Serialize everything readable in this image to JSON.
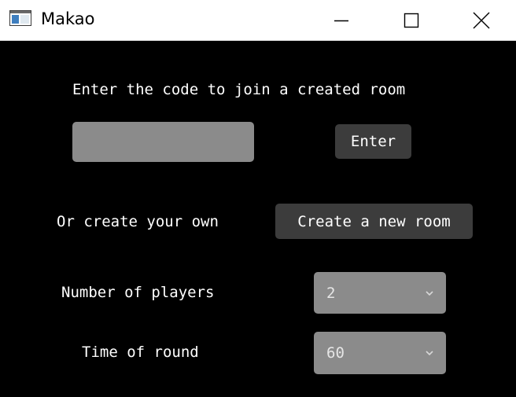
{
  "window": {
    "title": "Makao",
    "icon": "app-window-icon",
    "controls": {
      "minimize_icon": "minimize-icon",
      "maximize_icon": "maximize-icon",
      "close_icon": "close-icon"
    }
  },
  "join": {
    "prompt": "Enter the code to join a created room",
    "code_value": "",
    "code_placeholder": "",
    "enter_label": "Enter"
  },
  "create": {
    "prompt": "Or create your own",
    "button_label": "Create a new room"
  },
  "settings": {
    "players_label": "Number of players",
    "players_value": "2",
    "round_label": "Time of round",
    "round_value": "60"
  },
  "colors": {
    "background": "#000000",
    "text": "#ffffff",
    "button": "#3c3c3c",
    "input": "#8b8b8b"
  }
}
